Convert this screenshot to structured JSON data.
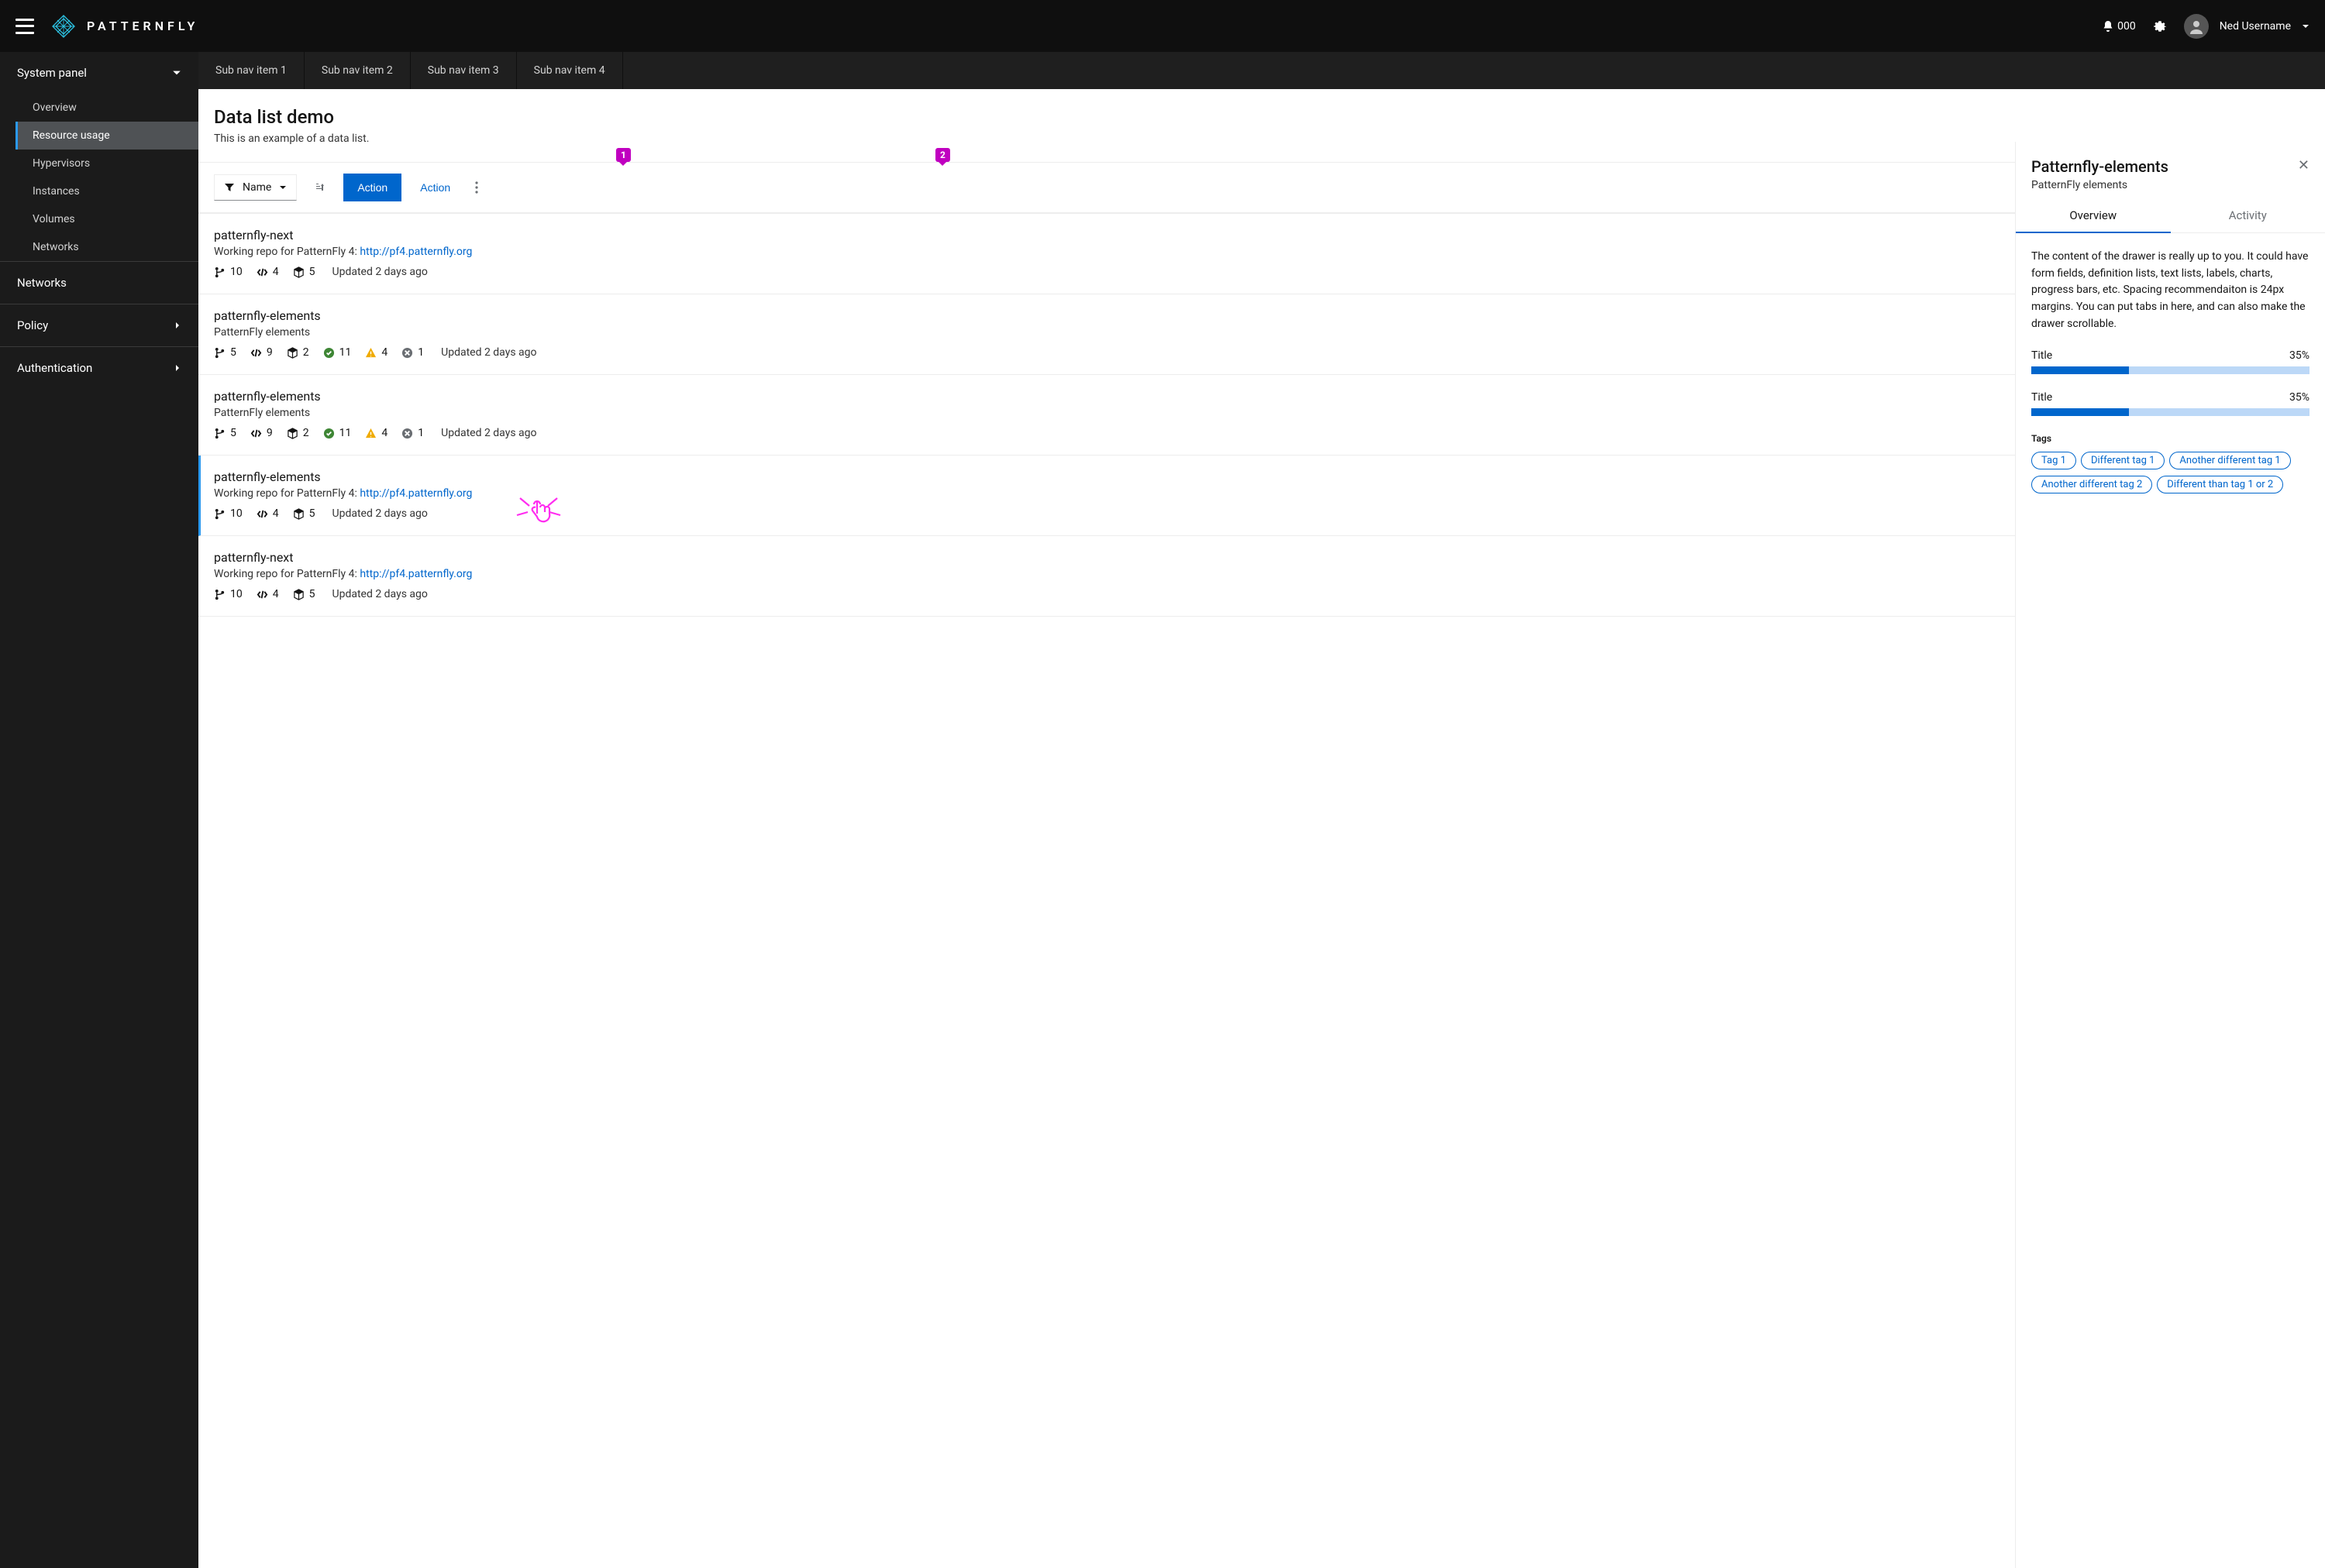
{
  "header": {
    "brand": "PATTERNFLY",
    "badge": "000",
    "username": "Ned Username"
  },
  "sidebar": {
    "group0": {
      "label": "System panel",
      "expanded": true
    },
    "items": [
      "Overview",
      "Resource usage",
      "Hypervisors",
      "Instances",
      "Volumes",
      "Networks"
    ],
    "group1": "Networks",
    "group2": "Policy",
    "group3": "Authentication"
  },
  "subnav": [
    "Sub nav item 1",
    "Sub nav item 2",
    "Sub nav item 3",
    "Sub nav item 4"
  ],
  "page": {
    "title": "Data list demo",
    "desc": "This is an example of a data list."
  },
  "toolbar": {
    "filter_label": "Name",
    "action_primary": "Action",
    "action_link": "Action"
  },
  "list": [
    {
      "title": "patternfly-next",
      "desc": "Working repo for PatternFly 4: ",
      "link": "http://pf4.patternfly.org",
      "branches": "10",
      "code": "4",
      "pkg": "5",
      "ok": null,
      "warn": null,
      "err": null,
      "updated": "Updated 2 days ago"
    },
    {
      "title": "patternfly-elements",
      "desc": "PatternFly elements",
      "link": null,
      "branches": "5",
      "code": "9",
      "pkg": "2",
      "ok": "11",
      "warn": "4",
      "err": "1",
      "updated": "Updated 2 days ago"
    },
    {
      "title": "patternfly-elements",
      "desc": "PatternFly elements",
      "link": null,
      "branches": "5",
      "code": "9",
      "pkg": "2",
      "ok": "11",
      "warn": "4",
      "err": "1",
      "updated": "Updated 2 days ago"
    },
    {
      "title": "patternfly-elements",
      "desc": "Working repo for PatternFly 4: ",
      "link": "http://pf4.patternfly.org",
      "branches": "10",
      "code": "4",
      "pkg": "5",
      "ok": null,
      "warn": null,
      "err": null,
      "updated": "Updated 2 days ago",
      "selected": true
    },
    {
      "title": "patternfly-next",
      "desc": "Working repo for PatternFly 4: ",
      "link": "http://pf4.patternfly.org",
      "branches": "10",
      "code": "4",
      "pkg": "5",
      "ok": null,
      "warn": null,
      "err": null,
      "updated": "Updated 2 days ago"
    }
  ],
  "drawer": {
    "title": "Patternfly-elements",
    "subtitle": "PatternFly elements",
    "tabs": {
      "overview": "Overview",
      "activity": "Activity"
    },
    "body": "The content of the drawer is really up to you. It could have form fields, definition lists, text lists, labels, charts, progress bars, etc. Spacing recommendaiton is 24px margins. You can put tabs in here, and can also make the drawer scrollable.",
    "progress": [
      {
        "label": "Title",
        "pct": "35%",
        "val": 35
      },
      {
        "label": "Title",
        "pct": "35%",
        "val": 35
      }
    ],
    "tags_label": "Tags",
    "tags": [
      "Tag 1",
      "Different tag 1",
      "Another different tag 1",
      "Another different tag 2",
      "Different than tag 1 or 2"
    ]
  },
  "pins": {
    "p1": "1",
    "p2": "2"
  }
}
